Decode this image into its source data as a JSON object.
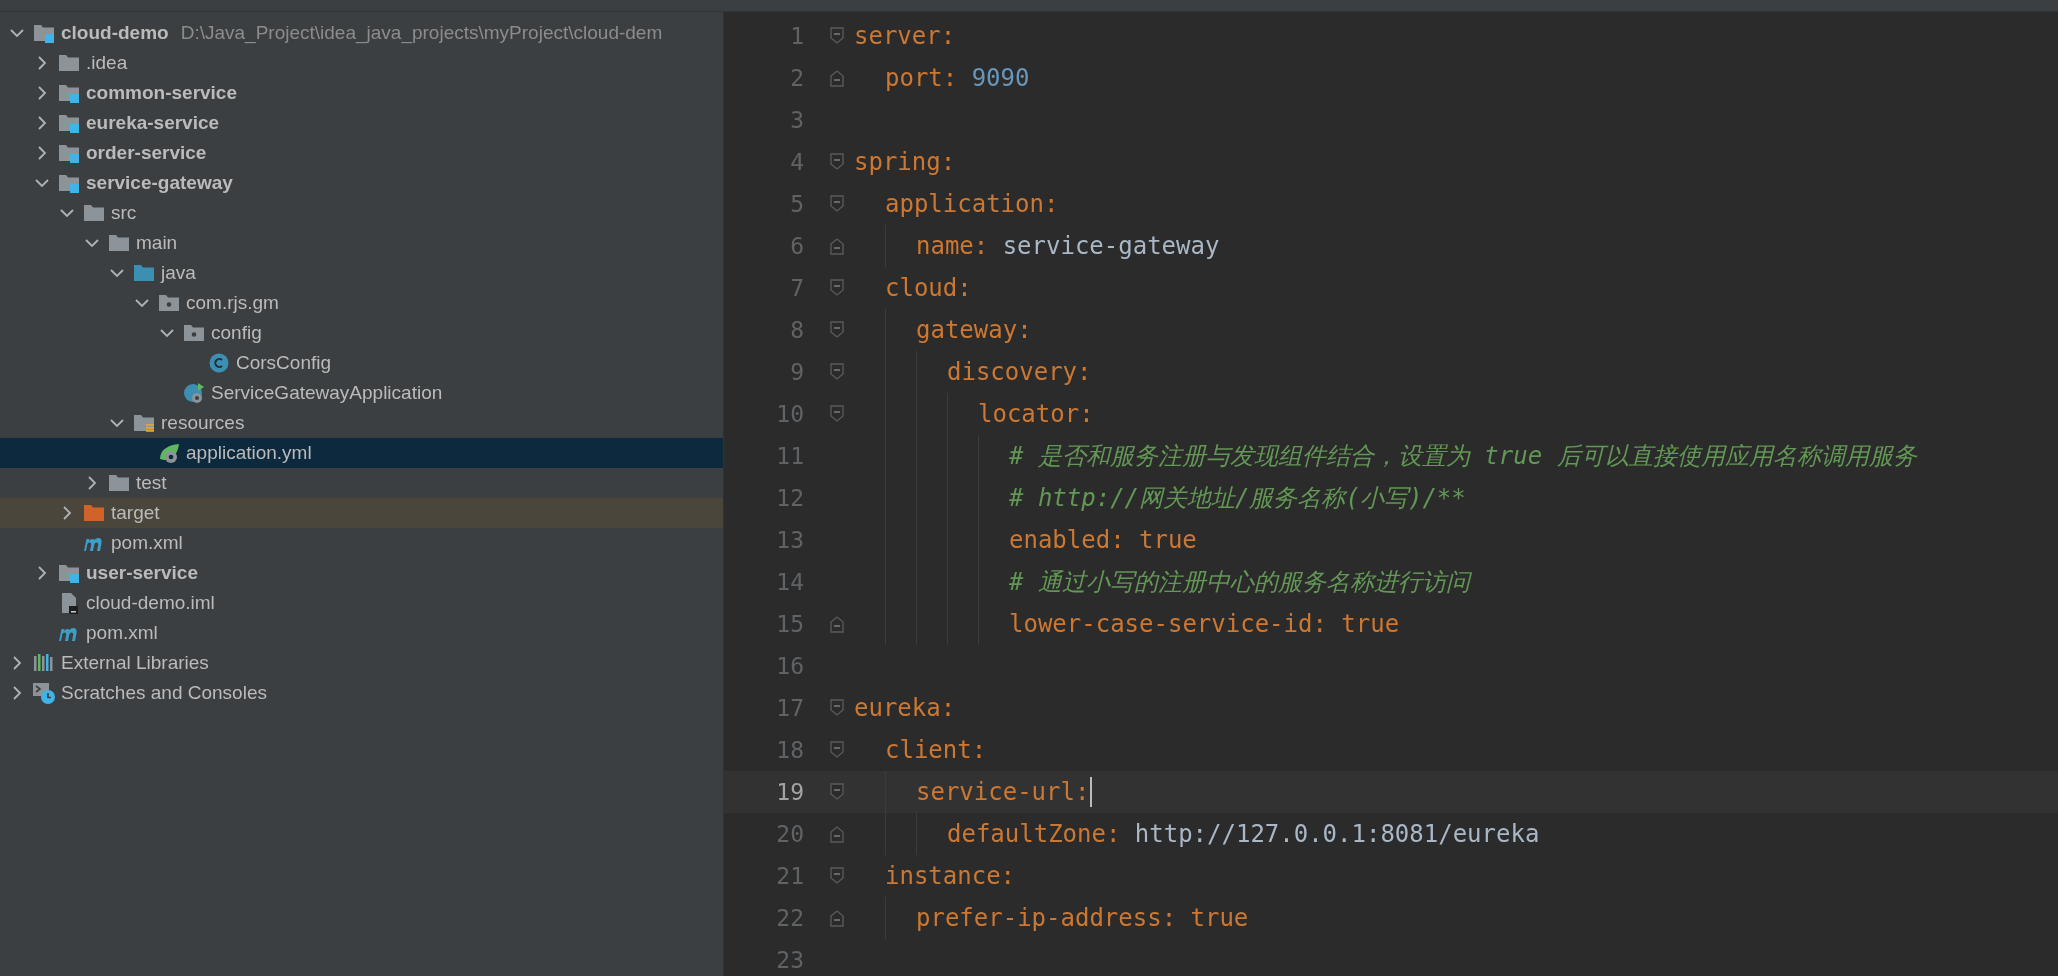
{
  "project_tree": {
    "items": [
      {
        "label": "cloud-demo",
        "kind": "module",
        "path": "D:\\Java_Project\\idea_java_projects\\myProject\\cloud-dem",
        "expanded": true,
        "selected": false,
        "children": [
          {
            "label": ".idea",
            "kind": "folder",
            "expanded": false,
            "selected": false
          },
          {
            "label": "common-service",
            "kind": "module",
            "expanded": false,
            "selected": false
          },
          {
            "label": "eureka-service",
            "kind": "module",
            "expanded": false,
            "selected": false
          },
          {
            "label": "order-service",
            "kind": "module",
            "expanded": false,
            "selected": false
          },
          {
            "label": "service-gateway",
            "kind": "module",
            "expanded": true,
            "selected": false,
            "children": [
              {
                "label": "src",
                "kind": "folder",
                "expanded": true,
                "selected": false,
                "children": [
                  {
                    "label": "main",
                    "kind": "folder",
                    "expanded": true,
                    "selected": false,
                    "children": [
                      {
                        "label": "java",
                        "kind": "source-folder",
                        "expanded": true,
                        "selected": false,
                        "children": [
                          {
                            "label": "com.rjs.gm",
                            "kind": "package",
                            "expanded": true,
                            "selected": false,
                            "children": [
                              {
                                "label": "config",
                                "kind": "package",
                                "expanded": true,
                                "selected": false,
                                "children": [
                                  {
                                    "label": "CorsConfig",
                                    "kind": "class",
                                    "selected": false
                                  }
                                ]
                              },
                              {
                                "label": "ServiceGatewayApplication",
                                "kind": "boot-class",
                                "selected": false
                              }
                            ]
                          }
                        ]
                      },
                      {
                        "label": "resources",
                        "kind": "resources-folder",
                        "expanded": true,
                        "selected": false,
                        "children": [
                          {
                            "label": "application.yml",
                            "kind": "boot-config",
                            "selected": true
                          }
                        ]
                      }
                    ]
                  },
                  {
                    "label": "test",
                    "kind": "folder",
                    "expanded": false,
                    "selected": false
                  }
                ]
              },
              {
                "label": "target",
                "kind": "excluded-folder",
                "expanded": false,
                "selected": false
              },
              {
                "label": "pom.xml",
                "kind": "maven",
                "selected": false
              }
            ]
          },
          {
            "label": "user-service",
            "kind": "module",
            "expanded": false,
            "selected": false
          },
          {
            "label": "cloud-demo.iml",
            "kind": "iml",
            "selected": false
          },
          {
            "label": "pom.xml",
            "kind": "maven",
            "selected": false
          }
        ]
      },
      {
        "label": "External Libraries",
        "kind": "libraries",
        "expanded": false,
        "selected": false
      },
      {
        "label": "Scratches and Consoles",
        "kind": "scratches",
        "expanded": false,
        "selected": false
      }
    ]
  },
  "editor": {
    "lines": [
      {
        "number": "1",
        "current": false,
        "key": "server:",
        "children": [
          {
            "number": "2",
            "current": false,
            "key": "port:",
            "value": {
              "kind": "number",
              "text": "9090"
            }
          }
        ]
      },
      {
        "number": "3",
        "current": false
      },
      {
        "number": "4",
        "current": false,
        "key": "spring:",
        "children": [
          {
            "number": "5",
            "current": false,
            "key": "application:",
            "children": [
              {
                "number": "6",
                "current": false,
                "key": "name:",
                "value": {
                  "kind": "plain",
                  "text": "service-gateway"
                }
              }
            ]
          },
          {
            "number": "7",
            "current": false,
            "key": "cloud:",
            "children": [
              {
                "number": "8",
                "current": false,
                "key": "gateway:",
                "children": [
                  {
                    "number": "9",
                    "current": false,
                    "key": "discovery:",
                    "children": [
                      {
                        "number": "10",
                        "current": false,
                        "key": "locator:",
                        "children": [
                          {
                            "number": "11",
                            "current": false,
                            "comment": "# 是否和服务注册与发现组件结合，设置为 true 后可以直接使用应用名称调用服务"
                          },
                          {
                            "number": "12",
                            "current": false,
                            "comment": "# http://网关地址/服务名称(小写)/**"
                          },
                          {
                            "number": "13",
                            "current": false,
                            "key": "enabled:",
                            "value": {
                              "kind": "bool",
                              "text": "true"
                            }
                          },
                          {
                            "number": "14",
                            "current": false,
                            "comment": "# 通过小写的注册中心的服务名称进行访问"
                          },
                          {
                            "number": "15",
                            "current": false,
                            "key": "lower-case-service-id:",
                            "value": {
                              "kind": "bool",
                              "text": "true"
                            }
                          }
                        ]
                      }
                    ]
                  }
                ]
              }
            ]
          }
        ]
      },
      {
        "number": "16",
        "current": false
      },
      {
        "number": "17",
        "current": false,
        "key": "eureka:",
        "children": [
          {
            "number": "18",
            "current": false,
            "key": "client:",
            "children": [
              {
                "number": "19",
                "current": true,
                "key": "service-url:",
                "children": [
                  {
                    "number": "20",
                    "current": false,
                    "key": "defaultZone:",
                    "value": {
                      "kind": "plain",
                      "text": "http://127.0.0.1:8081/eureka"
                    }
                  }
                ]
              }
            ]
          },
          {
            "number": "21",
            "current": false,
            "key": "instance:",
            "children": [
              {
                "number": "22",
                "current": false,
                "key": "prefer-ip-address:",
                "value": {
                  "kind": "bool",
                  "text": "true"
                }
              }
            ]
          }
        ]
      },
      {
        "number": "23",
        "current": false
      }
    ]
  }
}
